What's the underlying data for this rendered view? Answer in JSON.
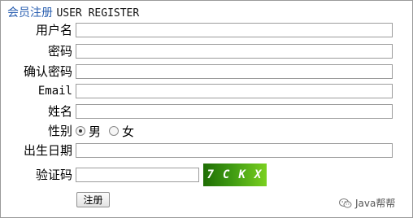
{
  "header": {
    "title_cn": "会员注册",
    "title_en": "USER REGISTER"
  },
  "form": {
    "username_label": "用户名",
    "username_value": "",
    "password_label": "密码",
    "password_value": "",
    "confirm_password_label": "确认密码",
    "confirm_password_value": "",
    "email_label": "Email",
    "email_value": "",
    "name_label": "姓名",
    "name_value": "",
    "gender_label": "性别",
    "gender_options": [
      "男",
      "女"
    ],
    "gender_selected": "男",
    "birthday_label": "出生日期",
    "birthday_value": "",
    "captcha_label": "验证码",
    "captcha_value": "",
    "captcha_text": [
      "7",
      "C",
      "K",
      "X"
    ],
    "submit_label": "注册"
  },
  "watermark": {
    "text": "Java帮帮",
    "icon": "wechat-icon"
  },
  "colors": {
    "title_cn": "#2a5fb0",
    "captcha_bg_start": "#1f6d05",
    "captcha_bg_end": "#7ad020",
    "frame_border": "#9a9a9a"
  }
}
